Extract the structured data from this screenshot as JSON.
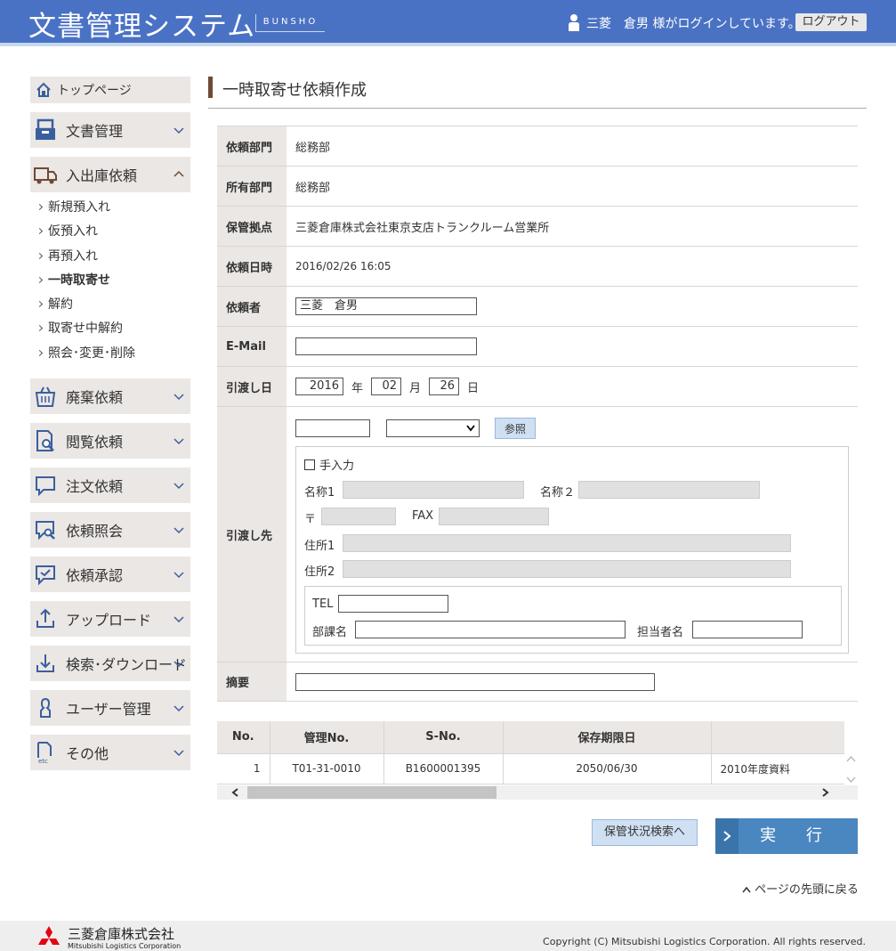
{
  "header": {
    "app_title": "文書管理システム",
    "app_subtitle": "BUNSHO",
    "login_text": "三菱　倉男 様がログインしています。",
    "logout_label": "ログアウト"
  },
  "sidebar": {
    "top_label": "トップページ",
    "items": [
      {
        "label": "文書管理"
      },
      {
        "label": "入出庫依頼"
      },
      {
        "label": "廃棄依頼"
      },
      {
        "label": "閲覧依頼"
      },
      {
        "label": "注文依頼"
      },
      {
        "label": "依頼照会"
      },
      {
        "label": "依頼承認"
      },
      {
        "label": "アップロード"
      },
      {
        "label": "検索･ダウンロード"
      },
      {
        "label": "ユーザー管理"
      },
      {
        "label": "その他"
      }
    ],
    "sub_items": [
      "新規預入れ",
      "仮預入れ",
      "再預入れ",
      "一時取寄せ",
      "解約",
      "取寄せ中解約",
      "照会･変更･削除"
    ]
  },
  "main": {
    "page_title": "一時取寄せ依頼作成",
    "form": {
      "dept_label": "依頼部門",
      "dept_value": "総務部",
      "owner_label": "所有部門",
      "owner_value": "総務部",
      "base_label": "保管拠点",
      "base_value": "三菱倉庫株式会社東京支店トランクルーム営業所",
      "date_label": "依頼日時",
      "date_value": "2016/02/26 16:05",
      "requester_label": "依頼者",
      "requester_value": "三菱　倉男",
      "email_label": "E-Mail",
      "email_value": "",
      "delivery_label": "引渡し日",
      "delivery_year": "2016",
      "delivery_month": "02",
      "delivery_day": "26",
      "year_unit": "年",
      "month_unit": "月",
      "day_unit": "日",
      "dest_label": "引渡し先",
      "ref_button": "参照",
      "manual_label": "手入力",
      "name1_label": "名称1",
      "name2_label": "名称２",
      "zip_label": "〒",
      "fax_label": "FAX",
      "addr1_label": "住所1",
      "addr2_label": "住所2",
      "tel_label": "TEL",
      "section_label": "部課名",
      "person_label": "担当者名",
      "summary_label": "摘要"
    },
    "table": {
      "headers": [
        "No.",
        "管理No.",
        "S-No.",
        "保存期限日",
        ""
      ],
      "rows": [
        [
          "1",
          "T01-31-0010",
          "B1600001395",
          "2050/06/30",
          "2010年度資料"
        ]
      ]
    },
    "search_button": "保管状況検索へ",
    "exec_button": "実 行",
    "to_top": "ページの先頭に戻る"
  },
  "footer": {
    "company": "三菱倉庫株式会社",
    "company_en": "Mitsubishi Logistics Corporation",
    "copyright": "Copyright (C) Mitsubishi Logistics Corporation. All rights reserved."
  },
  "icons": {
    "header_user": "user-icon",
    "home": "home-icon",
    "chevron": "chevron-down-icon"
  },
  "colors": {
    "header_bg": "#4a72c4",
    "sidebar_bg": "#ebe7e4",
    "exec_button": "#4a87c0",
    "title_bar": "#6e4a33"
  }
}
